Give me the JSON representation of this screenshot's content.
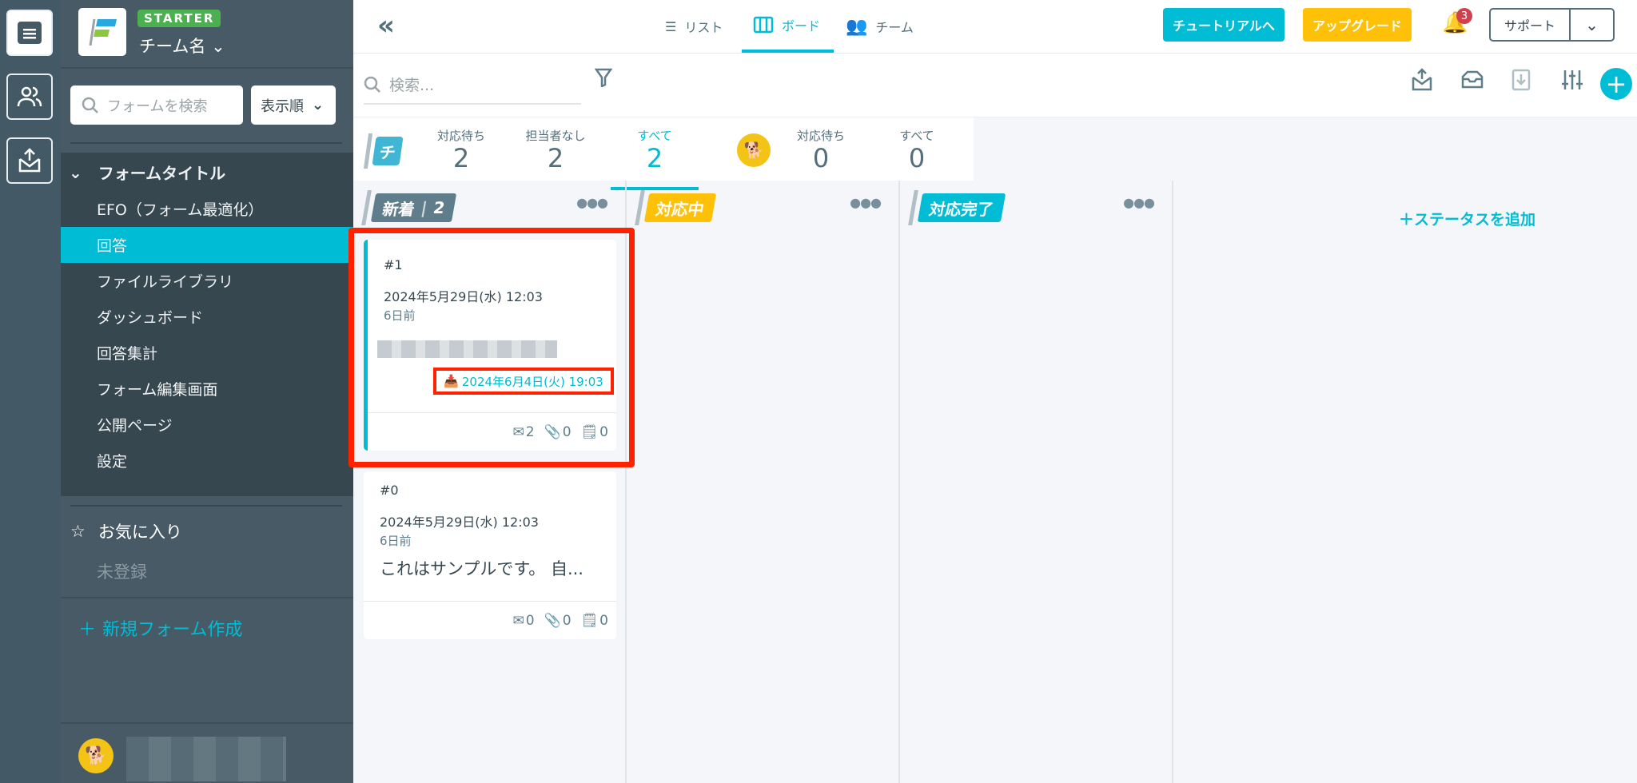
{
  "sidebar": {
    "plan_badge": "STARTER",
    "team_name": "チーム名",
    "search_placeholder": "フォームを検索",
    "sort_label": "表示順",
    "form_title": "フォームタイトル",
    "items": [
      {
        "label": "EFO（フォーム最適化）"
      },
      {
        "label": "回答"
      },
      {
        "label": "ファイルライブラリ"
      },
      {
        "label": "ダッシュボード"
      },
      {
        "label": "回答集計"
      },
      {
        "label": "フォーム編集画面"
      },
      {
        "label": "公開ページ"
      },
      {
        "label": "設定"
      }
    ],
    "favorites_label": "お気に入り",
    "favorites_empty": "未登録",
    "new_form": "新規フォーム作成"
  },
  "header": {
    "tabs": [
      {
        "label": "リスト"
      },
      {
        "label": "ボード"
      },
      {
        "label": "チーム"
      }
    ],
    "tutorial": "チュートリアルへ",
    "upgrade": "アップグレード",
    "notification_count": "3",
    "support": "サポート"
  },
  "toolbar": {
    "search_placeholder": "検索..."
  },
  "stats": {
    "team_initial": "チ",
    "team": [
      {
        "label": "対応待ち",
        "value": "2"
      },
      {
        "label": "担当者なし",
        "value": "2"
      },
      {
        "label": "すべて",
        "value": "2"
      }
    ],
    "me": [
      {
        "label": "対応待ち",
        "value": "0"
      },
      {
        "label": "すべて",
        "value": "0"
      }
    ]
  },
  "columns": [
    {
      "title": "新着",
      "count": "2",
      "color": "#607d8b"
    },
    {
      "title": "対応中",
      "color": "#ffc107"
    },
    {
      "title": "対応完了",
      "color": "#00bcd4"
    }
  ],
  "add_status": "ステータスを追加",
  "cards": [
    {
      "number": "#1",
      "date": "2024年5月29日(水) 12:03",
      "ago": "6日前",
      "received": "2024年6月4日(火) 19:03",
      "mail": "2",
      "attach": "0",
      "memo": "0"
    },
    {
      "number": "#0",
      "date": "2024年5月29日(水) 12:03",
      "ago": "6日前",
      "excerpt": "これはサンプルです。 自...",
      "mail": "0",
      "attach": "0",
      "memo": "0"
    }
  ],
  "colors": {
    "accent": "#00bcd4",
    "sidebar": "#475a66",
    "highlight": "#ff2200"
  }
}
